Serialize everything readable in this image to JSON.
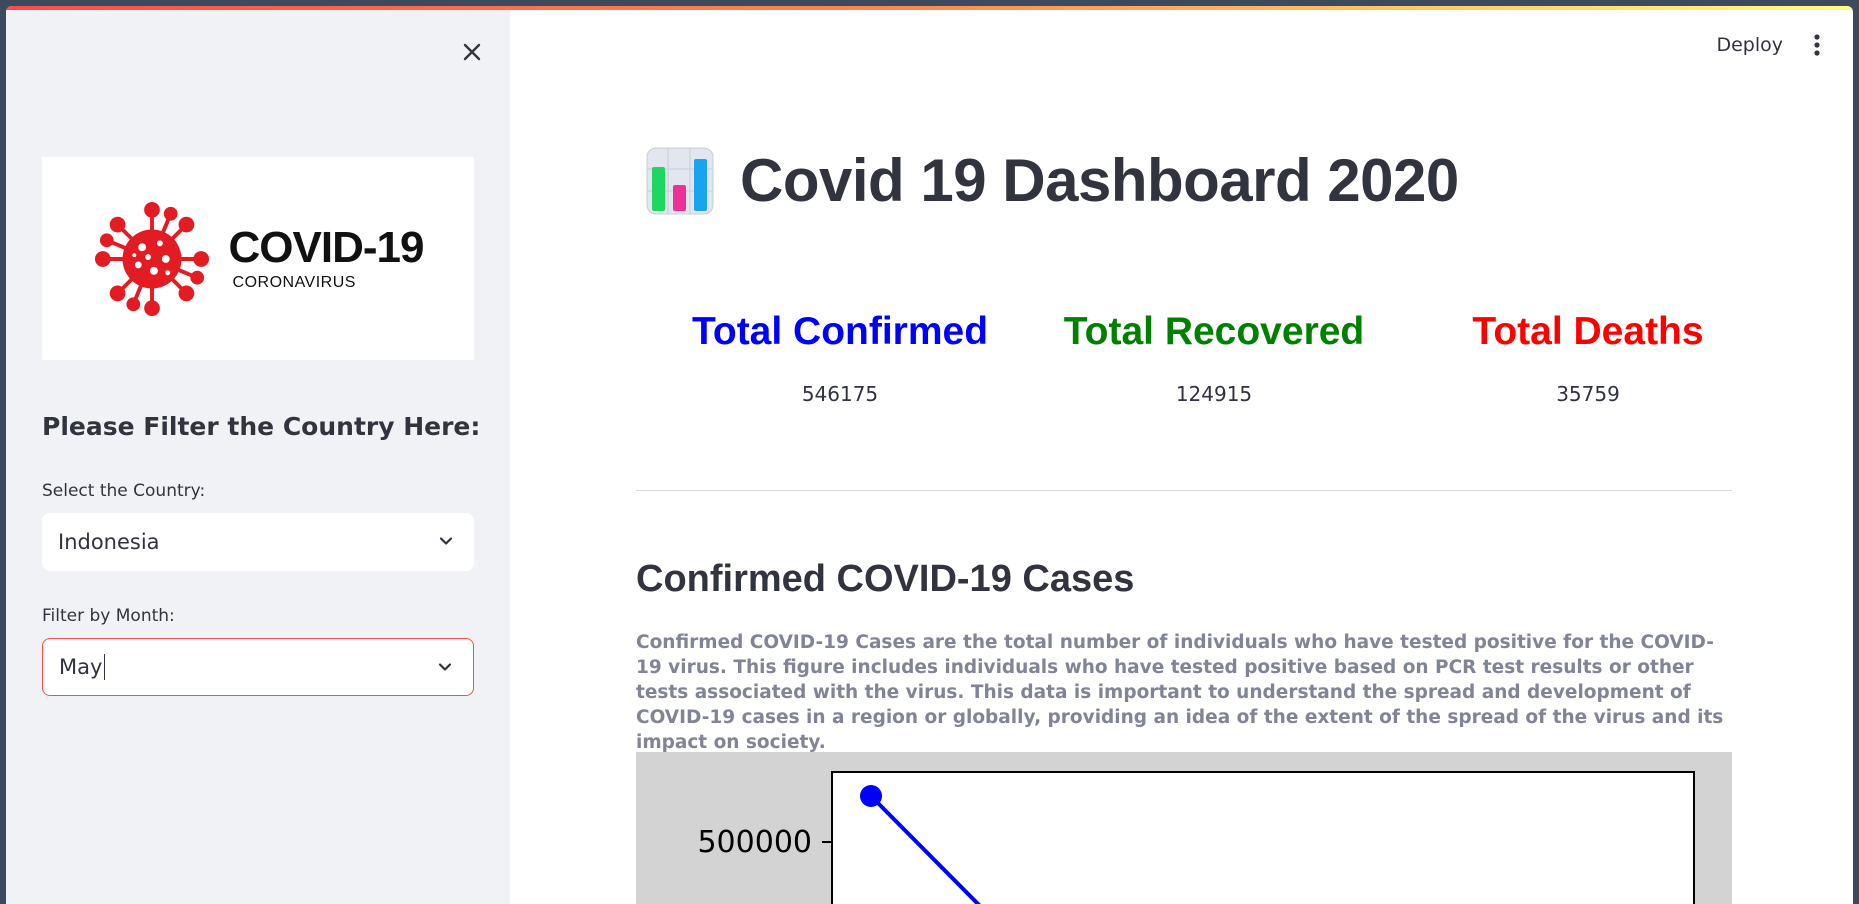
{
  "sidebar": {
    "logo": {
      "main": "COVID-19",
      "sub": "CORONAVIRUS"
    },
    "filter_heading": "Please Filter the Country Here:",
    "country": {
      "label": "Select the Country:",
      "value": "Indonesia"
    },
    "month": {
      "label": "Filter by Month:",
      "value": "May"
    }
  },
  "header": {
    "deploy_label": "Deploy"
  },
  "main": {
    "title": "Covid 19 Dashboard 2020",
    "metrics": [
      {
        "label": "Total Confirmed",
        "value": "546175",
        "color": "#0000ff"
      },
      {
        "label": "Total Recovered",
        "value": "124915",
        "color": "#008000"
      },
      {
        "label": "Total Deaths",
        "value": "35759",
        "color": "#ff0000"
      }
    ],
    "section_title": "Confirmed COVID-19 Cases",
    "section_desc": "Confirmed COVID-19 Cases are the total number of individuals who have tested positive for the COVID-19 virus. This figure includes individuals who have tested positive based on PCR test results or other tests associated with the virus. This data is important to understand the spread and development of COVID-19 cases in a region or globally, providing an idea of the extent of the spread of the virus and its impact on society."
  },
  "chart_data": {
    "type": "line",
    "y_tick_labels": [
      "500000"
    ],
    "series": [
      {
        "color": "#0000ff",
        "values": [
          546175
        ]
      }
    ]
  }
}
